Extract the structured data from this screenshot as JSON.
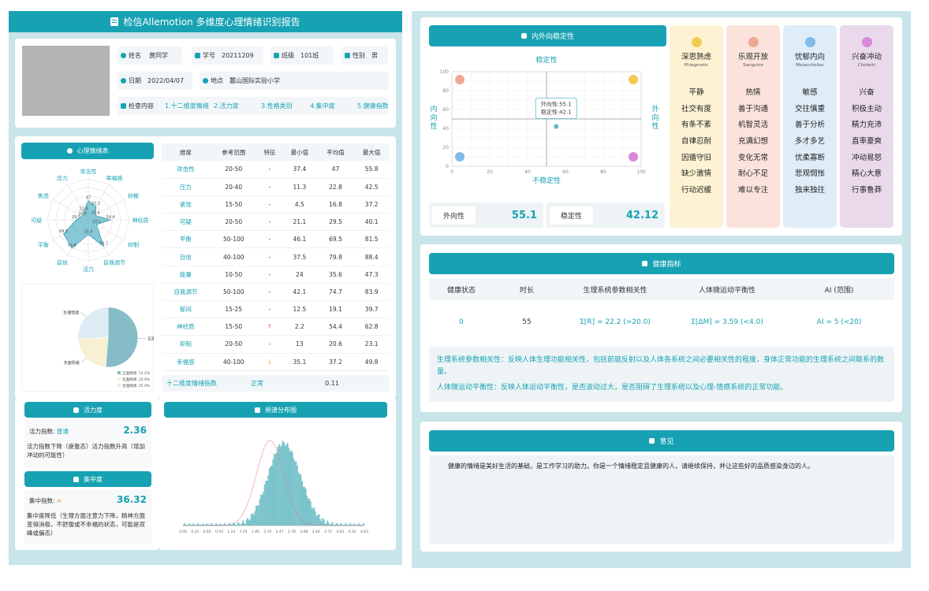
{
  "title": "检信Allemotion 多维度心理情绪识别报告",
  "profile": {
    "name_label": "姓名",
    "name": "黄同学",
    "id_label": "学号",
    "id": "20211209",
    "class_label": "班级",
    "class": "101班",
    "gender_label": "性别",
    "gender": "男",
    "date_label": "日期",
    "date": "2022/04/07",
    "location_label": "地点",
    "location": "麓山国际实验小学",
    "content_label": "检查内容",
    "content_items": [
      "1.十二维度情绪",
      "2.活力度",
      "3.性格类别",
      "4.集中度",
      "5.健康指数"
    ]
  },
  "emotion_table_header": "心理情绪表",
  "radar": {
    "labels": [
      "攻击性",
      "幸福感",
      "抑郁",
      "神经质",
      "抑制",
      "自我调节",
      "活力",
      "自信",
      "平衡",
      "可疑",
      "焦虑",
      "压力"
    ],
    "values": [
      47,
      37.2,
      20.6,
      54.4,
      23.1,
      74.7,
      35.6,
      79.8,
      69.5,
      29.5,
      16.8,
      22.8
    ],
    "max": 100
  },
  "chart_data": [
    {
      "type": "pie",
      "categories": [
        "正面情绪",
        "负面情绪",
        "生理情绪"
      ],
      "values": [
        51.2,
        22.9,
        25.9
      ],
      "legend": [
        "正面情绪: 51.2%",
        "负面情绪: 22.9%",
        "生理情绪: 25.9%"
      ],
      "colors": [
        "#86bcc8",
        "#f7f0d2",
        "#dcebf4"
      ]
    },
    {
      "type": "scatter",
      "title": "稳定性",
      "xlabel": "不稳定性",
      "ylabel_left": "内向性",
      "ylabel_right": "外向性",
      "x": [
        55.1
      ],
      "y": [
        42.1
      ],
      "xlim": [
        0,
        100
      ],
      "ylim": [
        0,
        100
      ],
      "xticks": [
        "0",
        "20",
        "40",
        "60",
        "80",
        "100"
      ],
      "yticks": [
        "0",
        "20",
        "40",
        "60",
        "80",
        "100"
      ],
      "tooltip": [
        "外向性:55.1",
        "稳定性:42.1"
      ]
    },
    {
      "type": "bar",
      "title": "频谱分布图",
      "xticks": [
        "0.00",
        "0.31",
        "0.62",
        "0.93",
        "1.24",
        "1.54",
        "1.85",
        "2.16",
        "2.47",
        "2.78",
        "3.08",
        "3.40",
        "3.71",
        "4.02",
        "4.32",
        "4.63"
      ]
    }
  ],
  "table": {
    "headers": [
      "维度",
      "参考范围",
      "特征",
      "最小值",
      "平均值",
      "最大值"
    ],
    "rows": [
      [
        "攻击性",
        "20-50",
        "-",
        "37.4",
        "47",
        "55.8"
      ],
      [
        "压力",
        "20-40",
        "-",
        "11.3",
        "22.8",
        "42.5"
      ],
      [
        "紧张",
        "15-50",
        "-",
        "4.5",
        "16.8",
        "37.2"
      ],
      [
        "可疑",
        "20-50",
        "-",
        "21.1",
        "29.5",
        "40.1"
      ],
      [
        "平衡",
        "50-100",
        "-",
        "46.1",
        "69.5",
        "81.5"
      ],
      [
        "自信",
        "40-100",
        "-",
        "37.5",
        "79.8",
        "88.4"
      ],
      [
        "能量",
        "10-50",
        "-",
        "24",
        "35.6",
        "47.3"
      ],
      [
        "自我调节",
        "50-100",
        "-",
        "42.1",
        "74.7",
        "83.9"
      ],
      [
        "郁闷",
        "15-25",
        "-",
        "12.5",
        "19.1",
        "39.7"
      ],
      [
        "神经质",
        "15-50",
        "↑",
        "2.2",
        "54.4",
        "62.8"
      ],
      [
        "抑制",
        "20-50",
        "-",
        "13",
        "20.6",
        "23.1"
      ],
      [
        "幸福感",
        "40-100",
        "↓",
        "35.1",
        "37.2",
        "49.8"
      ]
    ],
    "summary": [
      "十二维度情绪指数",
      "正常",
      "0.11"
    ]
  },
  "vitality": {
    "header": "活力度",
    "label": "活力指数:",
    "status": "普通",
    "value": "2.36",
    "desc": "活力指数下降（疲惫态）活力指数升高（增加冲动的可能性）"
  },
  "focus": {
    "header": "集中度",
    "label": "集中指数:",
    "value": "36.32",
    "desc": "集中度降低（生理方面注意力下降，精神方面变得消极，不舒服或不幸福的状态，可能是双峰或偏态）"
  },
  "spectrum_header": "频谱分布图",
  "stability": {
    "header": "内外向稳定性",
    "extro_label": "外向性",
    "extro_value": "55.1",
    "stab_label": "稳定性",
    "stab_value": "42.12"
  },
  "temperaments": [
    {
      "name": "深思熟虑",
      "en": "Phlegmatic",
      "bg": "#fdf3d3",
      "face": "#f2cb52",
      "traits": [
        "平静",
        "社交有度",
        "有条不紊",
        "自律忍耐",
        "因循守旧",
        "缺少激情",
        "行动迟缓"
      ]
    },
    {
      "name": "乐观开放",
      "en": "Sanguine",
      "bg": "#fbe3dc",
      "face": "#f0a893",
      "traits": [
        "热情",
        "善于沟通",
        "机智灵活",
        "充满幻想",
        "变化无常",
        "耐心不足",
        "难以专注"
      ]
    },
    {
      "name": "忧郁内向",
      "en": "Melancholiac",
      "bg": "#dfedf8",
      "face": "#82bbe7",
      "traits": [
        "敏感",
        "交往慎重",
        "善于分析",
        "多才多艺",
        "优柔寡断",
        "悲观惆怅",
        "独来独往"
      ]
    },
    {
      "name": "兴奋冲动",
      "en": "Choleric",
      "bg": "#ead9eb",
      "face": "#d988da",
      "traits": [
        "兴奋",
        "积极主动",
        "精力充沛",
        "直率豪爽",
        "冲动易怒",
        "精心大意",
        "行事鲁莽"
      ]
    }
  ],
  "health": {
    "header": "健康指标",
    "headers": [
      "健康状态",
      "时长",
      "生理系统参数相关性",
      "人体微运动平衡性",
      "AI (范围)"
    ],
    "row": [
      "0",
      "55",
      "Σ[R] = 22.2 (>20.0)",
      "Σ[ΔM] = 3.59 (<4.0)",
      "AI = 5 (<20)"
    ],
    "note1": "生理系统参数相关性：反映人体生理功能相关性，包括前庭反射以及人体各系统之间必要相关性的程度，身体正常功能的生理系统之间联系的数量。",
    "note2": "人体微运动平衡性：反映人体运动平衡性，是否波动过大，是否阻碍了生理系统以及心理-情感系统的正常功能。"
  },
  "opinion": {
    "header": "意见",
    "text": "健康的情绪是美好生活的基础，是工作学习的助力。你是一个情绪稳定且健康的人，请继续保持，并让这些好的品质感染身边的人。"
  },
  "colors": {
    "accent": "#17a2b3",
    "panel": "#c9e5e9",
    "pill": "#f2f6f8",
    "up": "#e24a4a",
    "down": "#f0a540"
  }
}
